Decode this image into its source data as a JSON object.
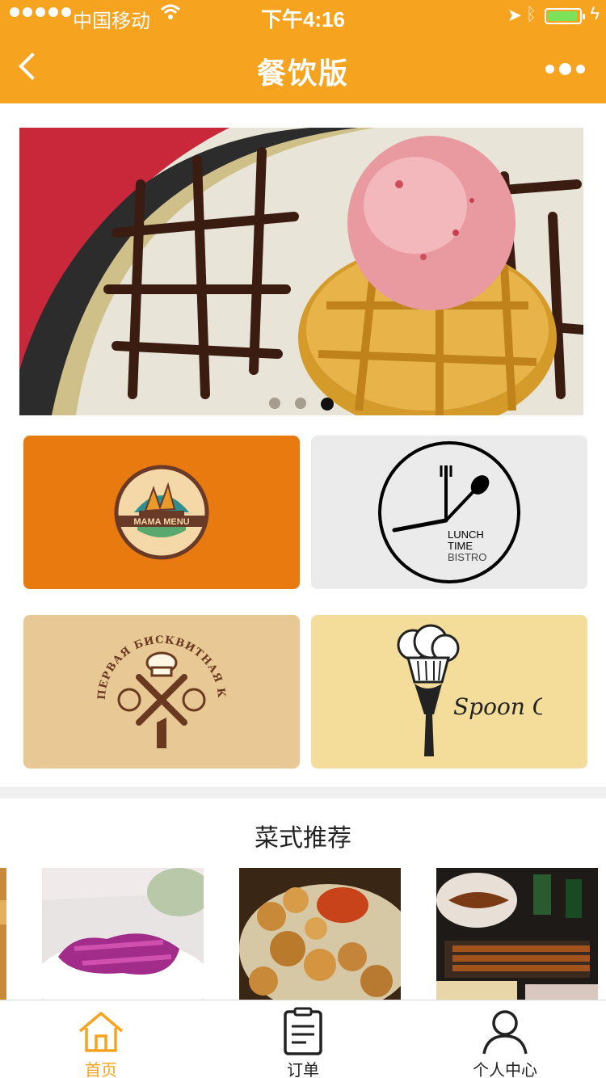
{
  "status_bar": {
    "carrier": "中国移动",
    "time": "下午4:16",
    "battery_level": 0.95
  },
  "nav": {
    "title": "餐饮版"
  },
  "banner": {
    "slide_count": 3,
    "active_slide": 3
  },
  "brands": [
    {
      "name": "MAMA MENU",
      "bg": "#e87a10"
    },
    {
      "name": "LUNCH TIME BISTRO",
      "line1": "LUNCH",
      "line2": "TIME",
      "line3": "BISTRO",
      "bg": "#ebebeb"
    },
    {
      "name": "ПЕРВАЯ БИСКВИТНАЯ КОМПАНИЯ",
      "bg": "#e8c996"
    },
    {
      "name": "Spoon Chef",
      "bg": "#f4dc9b"
    }
  ],
  "recommend": {
    "title": "菜式推荐",
    "dishes": [
      "dragon-fruit-chips",
      "fried-chicken",
      "bbq-skewers"
    ]
  },
  "tabbar": {
    "items": [
      {
        "label": "首页",
        "icon": "home-icon",
        "active": true
      },
      {
        "label": "订单",
        "icon": "order-icon",
        "active": false
      },
      {
        "label": "个人中心",
        "icon": "user-icon",
        "active": false
      }
    ],
    "active_color": "#f6a31f"
  },
  "colors": {
    "accent": "#f6a31f"
  }
}
